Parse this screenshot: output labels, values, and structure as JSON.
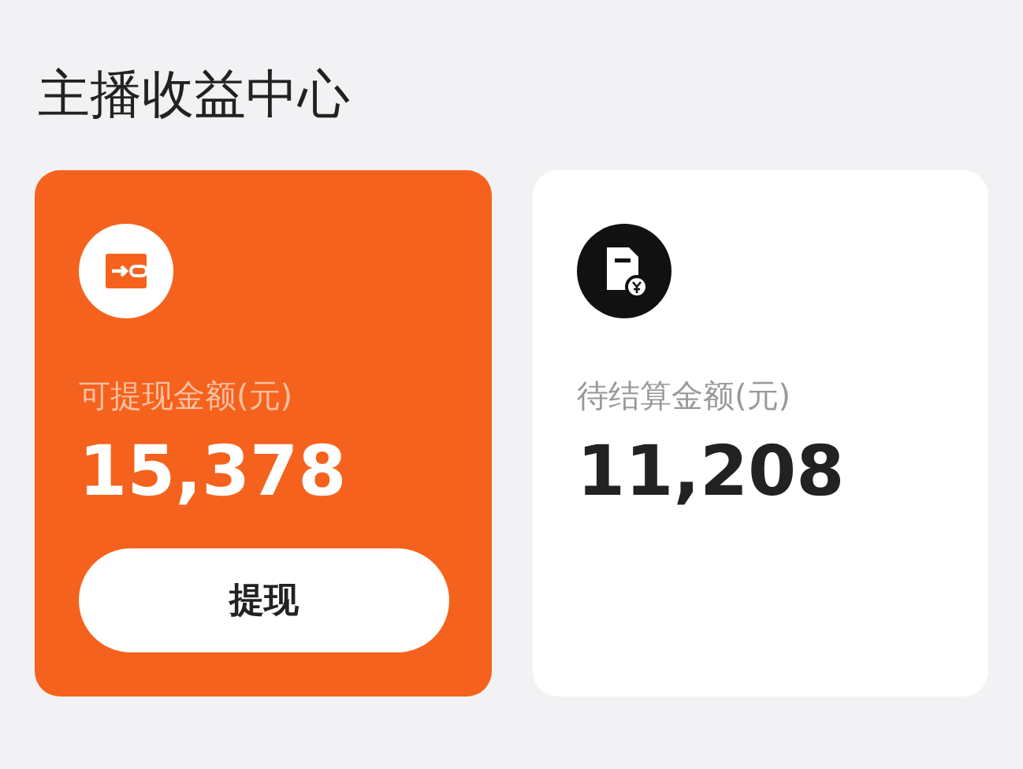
{
  "title": "主播收益中心",
  "cards": [
    {
      "kind": "withdrawable",
      "label": "可提现金额(元)",
      "amount": "15,378",
      "button": "提现"
    },
    {
      "kind": "pending",
      "label": "待结算金额(元)",
      "amount": "11,208"
    }
  ]
}
